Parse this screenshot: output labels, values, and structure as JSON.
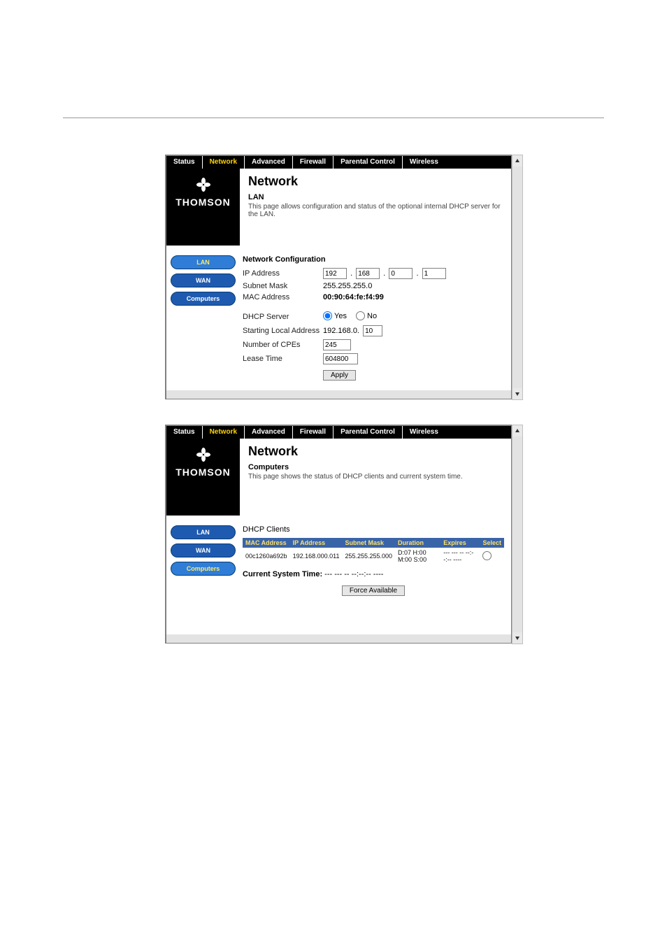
{
  "section_labels": {
    "fig18": "",
    "fig19": ""
  },
  "tabs": {
    "status": "Status",
    "network": "Network",
    "advanced": "Advanced",
    "firewall": "Firewall",
    "parental": "Parental Control",
    "wireless": "Wireless"
  },
  "brand": "THOMSON",
  "panel1": {
    "title": "Network",
    "subtitle": "LAN",
    "desc": "This page allows configuration and status of the optional internal DHCP server for the LAN.",
    "side": {
      "lan": "LAN",
      "wan": "WAN",
      "computers": "Computers"
    },
    "form_heading": "Network Configuration",
    "labels": {
      "ip": "IP Address",
      "subnet": "Subnet Mask",
      "mac": "MAC Address",
      "dhcp": "DHCP Server",
      "start": "Starting Local Address",
      "cpes": "Number of CPEs",
      "lease": "Lease Time"
    },
    "values": {
      "ip": [
        "192",
        "168",
        "0",
        "1"
      ],
      "subnet": "255.255.255.0",
      "mac": "00:90:64:fe:f4:99",
      "dhcp_yes": "Yes",
      "dhcp_no": "No",
      "start_prefix": "192.168.0.",
      "start": "10",
      "cpes": "245",
      "lease": "604800",
      "apply": "Apply"
    }
  },
  "panel2": {
    "title": "Network",
    "subtitle": "Computers",
    "desc": "This page shows the status of DHCP clients and current system time.",
    "side": {
      "lan": "LAN",
      "wan": "WAN",
      "computers": "Computers"
    },
    "list_heading": "DHCP Clients",
    "headers": {
      "mac": "MAC Address",
      "ip": "IP Address",
      "subnet": "Subnet Mask",
      "duration": "Duration",
      "expires": "Expires",
      "select": "Select"
    },
    "row": {
      "mac": "00c1260a692b",
      "ip": "192.168.000.011",
      "subnet": "255.255.255.000",
      "duration": "D:07 H:00 M:00 S:00",
      "expires": "--- --- -- --:--:-- ----"
    },
    "cst_label": "Current System Time:",
    "cst_value": "--- --- -- --:--:-- ----",
    "force_btn": "Force Available"
  }
}
